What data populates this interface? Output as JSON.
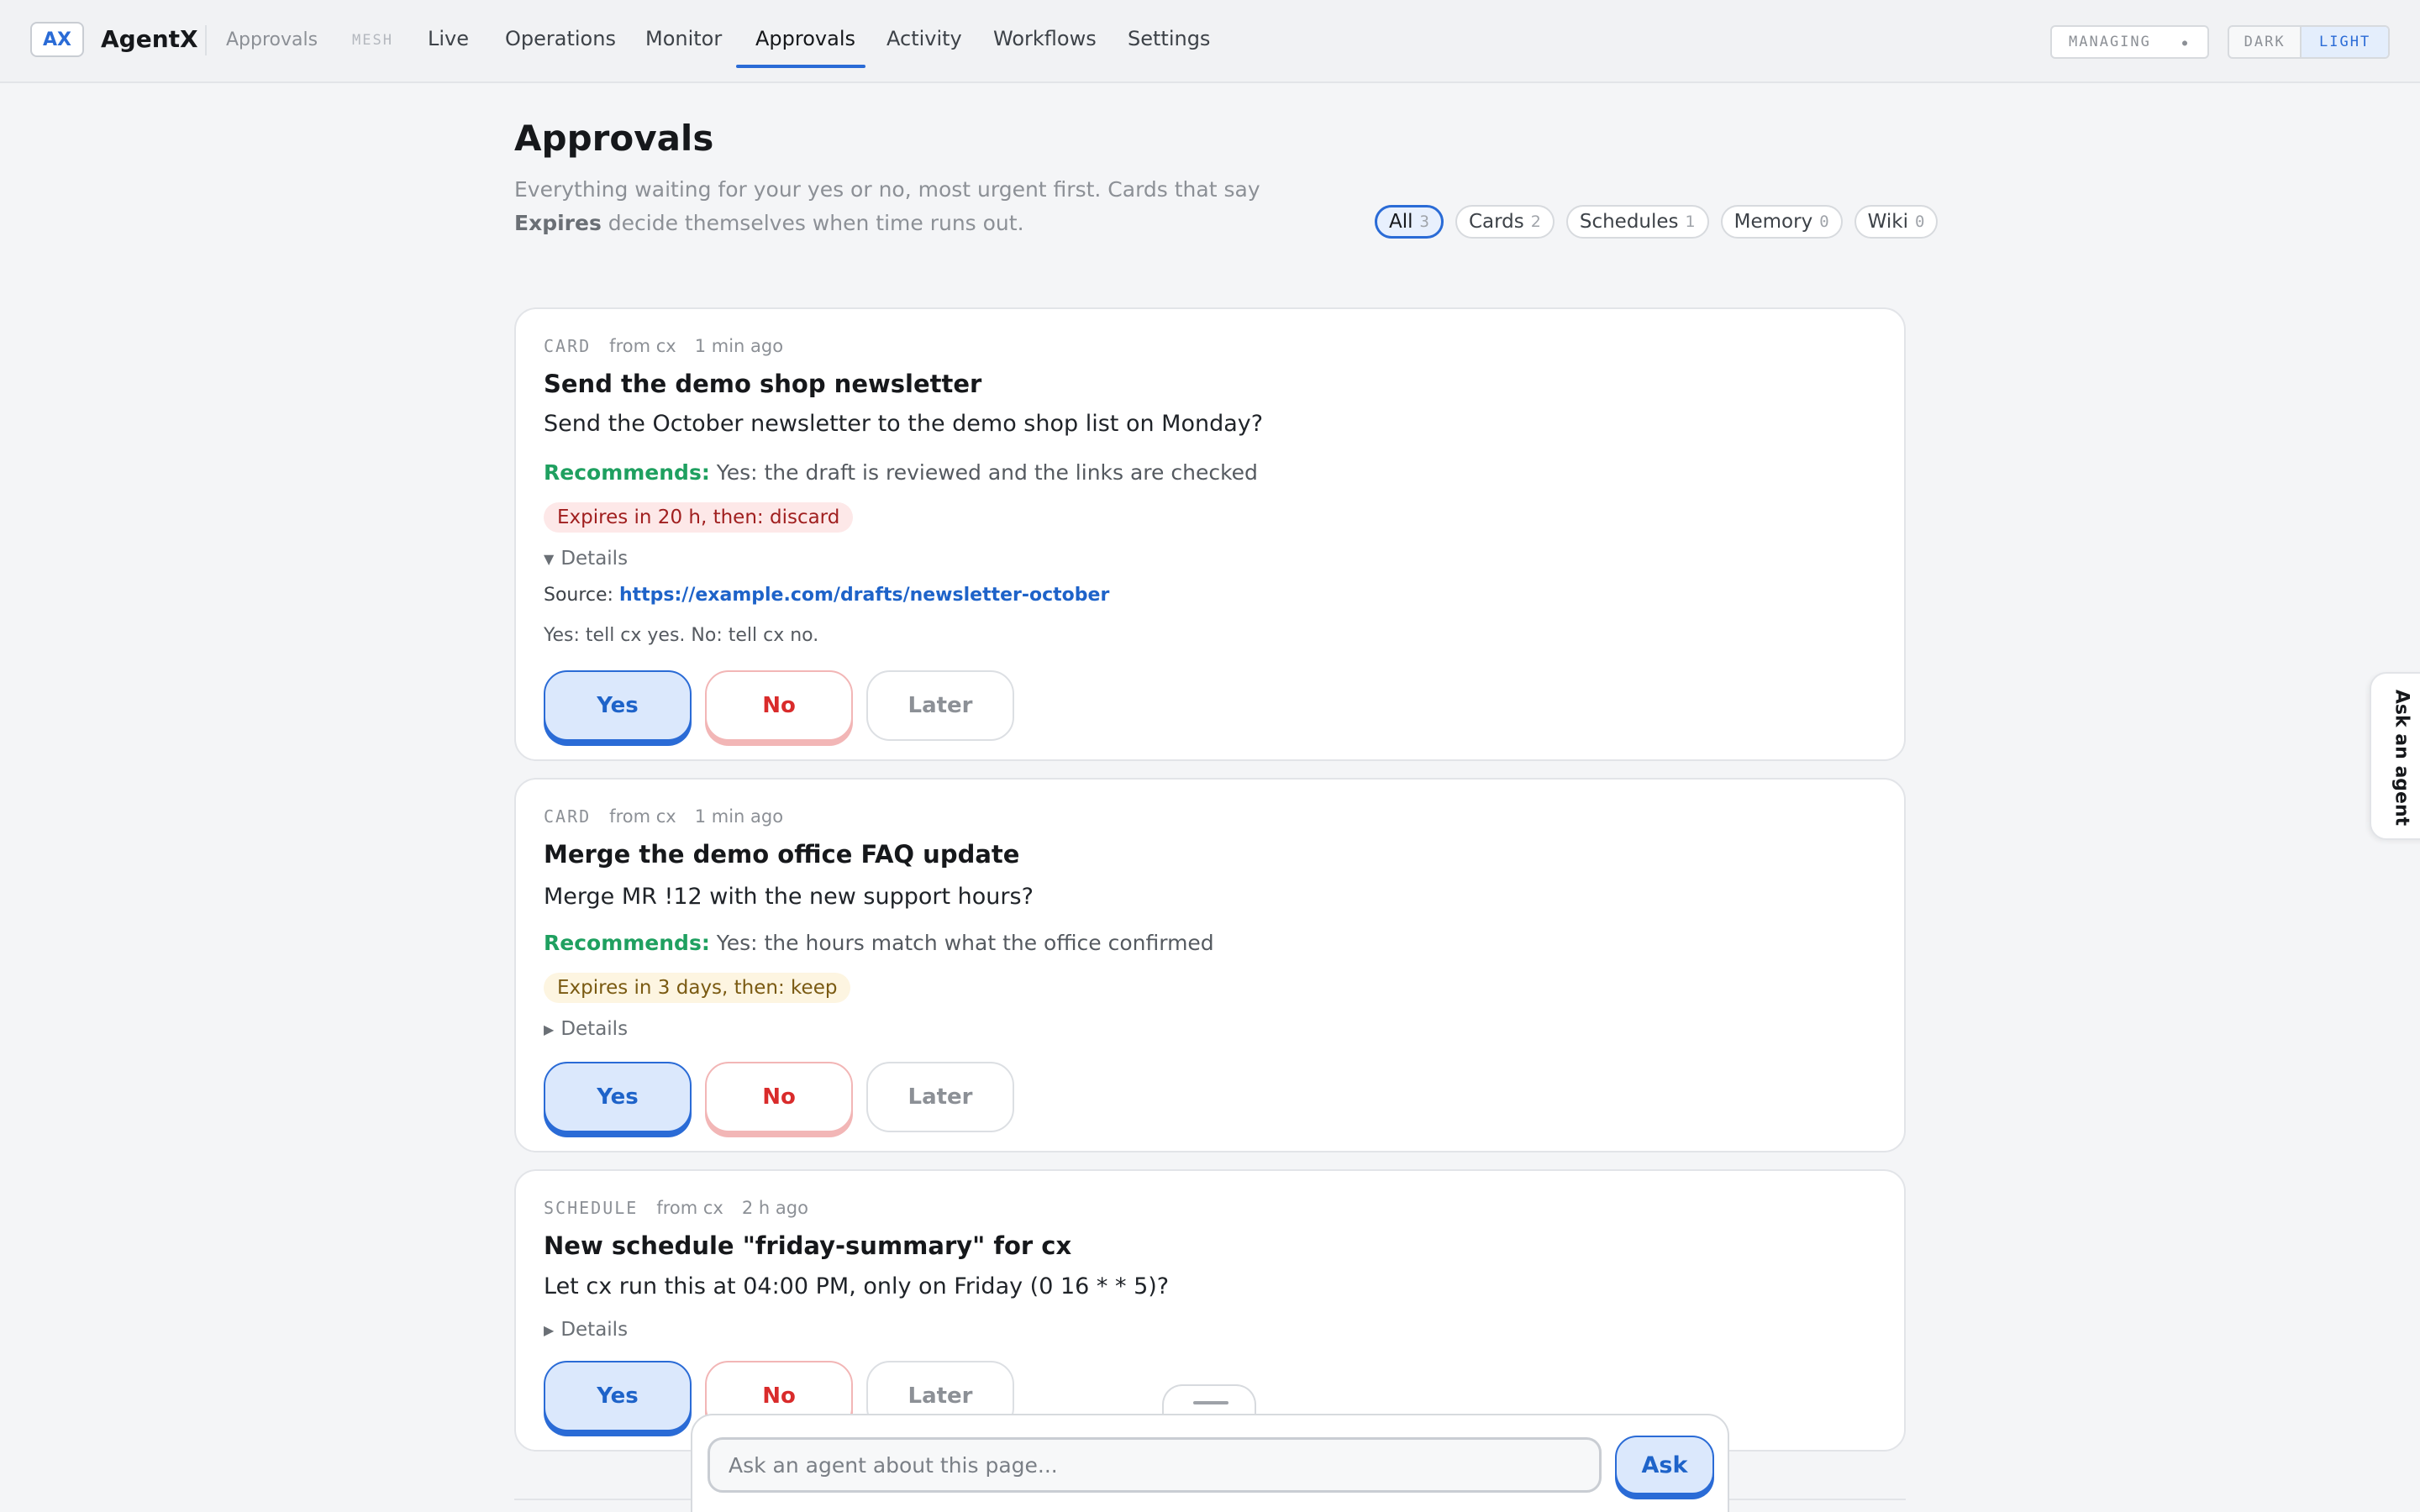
{
  "header": {
    "logo": "AX",
    "brand": "AgentX",
    "breadcrumb": "Approvals",
    "mesh": "MESH",
    "nav": [
      "Live",
      "Operations",
      "Monitor",
      "Approvals",
      "Activity",
      "Workflows",
      "Settings"
    ],
    "active_nav": "Approvals",
    "managing_label": "MANAGING",
    "theme": {
      "dark": "DARK",
      "light": "LIGHT",
      "selected": "LIGHT"
    }
  },
  "page": {
    "title": "Approvals",
    "subtitle_part1": "Everything waiting for your yes or no, most urgent first. Cards that say ",
    "subtitle_bold": "Expires",
    "subtitle_part2": " decide themselves when time runs out."
  },
  "filters": [
    {
      "label": "All",
      "count": "3",
      "active": true
    },
    {
      "label": "Cards",
      "count": "2",
      "active": false
    },
    {
      "label": "Schedules",
      "count": "1",
      "active": false
    },
    {
      "label": "Memory",
      "count": "0",
      "active": false
    },
    {
      "label": "Wiki",
      "count": "0",
      "active": false
    }
  ],
  "cards": [
    {
      "kind": "CARD",
      "from": "from cx",
      "age": "1 min ago",
      "title": "Send the demo shop newsletter",
      "question": "Send the October newsletter to the demo shop list on Monday?",
      "recommends_label": "Recommends:",
      "recommends_text": " Yes: the draft is reviewed and the links are checked",
      "expires": "Expires in 20 h, then: discard",
      "expires_tone": "red",
      "details_label": "Details",
      "details_open": true,
      "source_label": "Source: ",
      "source_url": "https://example.com/drafts/newsletter-october",
      "detail_note": "Yes: tell cx yes. No: tell cx no.",
      "buttons": {
        "yes": "Yes",
        "no": "No",
        "later": "Later"
      }
    },
    {
      "kind": "CARD",
      "from": "from cx",
      "age": "1 min ago",
      "title": "Merge the demo office FAQ update",
      "question": "Merge MR !12 with the new support hours?",
      "recommends_label": "Recommends:",
      "recommends_text": " Yes: the hours match what the office confirmed",
      "expires": "Expires in 3 days, then: keep",
      "expires_tone": "amber",
      "details_label": "Details",
      "details_open": false,
      "buttons": {
        "yes": "Yes",
        "no": "No",
        "later": "Later"
      }
    },
    {
      "kind": "SCHEDULE",
      "from": "from cx",
      "age": "2 h ago",
      "title": "New schedule \"friday-summary\" for cx",
      "question": "Let cx run this at 04:00 PM, only on Friday (0 16 * * 5)?",
      "details_label": "Details",
      "details_open": false,
      "buttons": {
        "yes": "Yes",
        "no": "No",
        "later": "Later"
      }
    }
  ],
  "side_tab": "Ask an agent",
  "ask": {
    "placeholder": "Ask an agent about this page...",
    "button": "Ask"
  },
  "icons": {
    "details_open": "triangle-down-icon",
    "details_closed": "triangle-right-icon",
    "managing_dropdown": "dropdown-dot-icon",
    "drawer_handle": "drag-handle-icon"
  },
  "colors": {
    "accent": "#2a6bd6",
    "recommend": "#1fa060",
    "danger": "#d92b2b",
    "expires_red_bg": "#fde8e8",
    "expires_amber_bg": "#fdf5e1"
  }
}
